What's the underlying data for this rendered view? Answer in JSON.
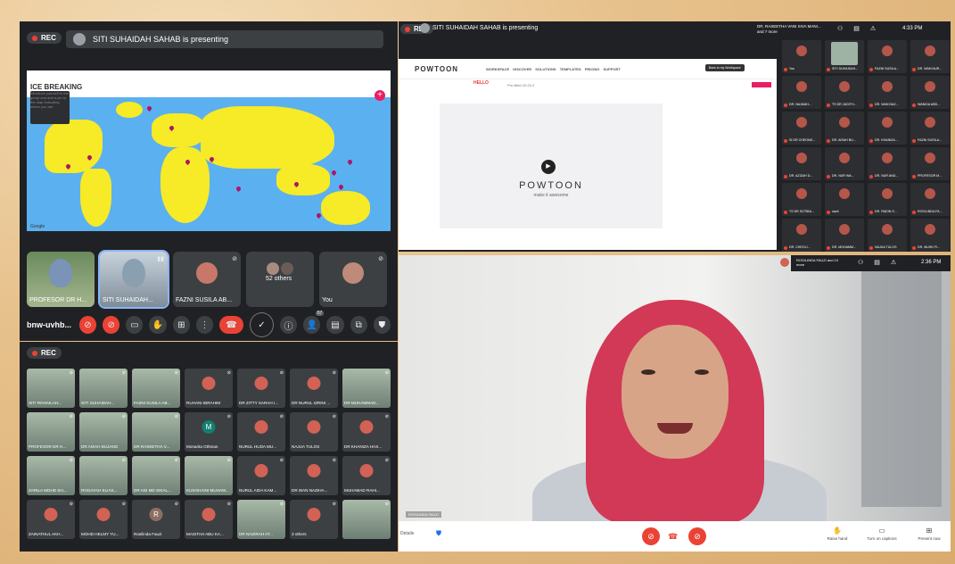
{
  "panel1": {
    "rec_label": "REC",
    "presenter_text": "SITI SUHAIDAH SAHAB is presenting",
    "map": {
      "title": "ICE BREAKING",
      "subtitle": "Introduce yourself to the group and add a pin to the map indicating where you are",
      "credit": "Google"
    },
    "tiles": [
      {
        "name": "PROFESOR DR H..."
      },
      {
        "name": "SITI SUHAIDAH..."
      },
      {
        "name": "FAZNI SUSILA AB..."
      },
      {
        "name": "52 others"
      },
      {
        "name": "You"
      }
    ],
    "meeting_code": "bnw-uvhb...",
    "people_count": "57"
  },
  "panel2": {
    "rec_label": "REC",
    "participants": [
      "SITI ROHAILAH...",
      "SITI SUHAIDAH...",
      "FAZNI SUSILA AB...",
      "RUHANI IBRAHIM",
      "DR ZITTY SARAH I...",
      "DR NURUL IZRINI ...",
      "DR MUHAMMAD...",
      "PROFESOR DR H...",
      "DR AISAH BUJANG",
      "DR RASEETHA V...",
      "Monarita Othman",
      "NURUL HUDA MU...",
      "NAJUA TULOS",
      "DR KHANIZA HAS...",
      "ZARILA MOHD SH...",
      "ROGAYAH ELIAS...",
      "DR ADI MD SIKAL...",
      "KUSOHAINI MUHAM...",
      "NURUL AIDA KAM...",
      "DR WAN NAZIHA...",
      "MUHAMAD RAHI...",
      "ZAINATHUL AKH...",
      "MOHD HELMY YU...",
      "Rosilinda Fauzi",
      "MASITAH ABU KA...",
      "DR NAZIRAH AT...",
      "3 others",
      ""
    ],
    "monarita_initial": "M",
    "rosilinda_initial": "R"
  },
  "panel3": {
    "rec_label": "REC",
    "presenter_text": "SITI SUHAIDAH SAHAB is presenting",
    "host_text": "DR. RASEETHA VANI SIVA MANI... and 7 more",
    "time": "4:33 PM",
    "site": {
      "logo": "POWTOON",
      "nav_links": "WORKSPACE DISCOVER SOLUTIONS TEMPLATES PRICING SUPPORT",
      "cta": "Back to my Workspace",
      "hello": "HELLO",
      "promo": "Pre-filled 20:23.2",
      "video_brand": "POWTOON",
      "video_tagline": "make it awesome"
    },
    "side_participants": [
      "You",
      "SITI SUHAIDAH...",
      "FAZNI SUSILA...",
      "DR. WAN NUR...",
      "DR. NAJMAH...",
      "TS DR JUDITH...",
      "DR. WAN NAZ...",
      "WANIDA ABD...",
      "SI DR CHEONG...",
      "DR. AISAH BU...",
      "DR. KHANIZA...",
      "FAZNI SUSILA...",
      "DR. AZIZAH D...",
      "DR. NUR WA...",
      "DR. NUR AND...",
      "PROFESOR M...",
      "TS DR SOTIBA...",
      "nazli",
      "DR. RADIN S...",
      "ROSILINDA FA...",
      "DR. CHEOLI...",
      "DR. MOHAMM...",
      "NAJUA TULOS",
      "DR. MUHD FI..."
    ]
  },
  "panel4": {
    "header_text": "ROSILINDA FAUZI and 10 more",
    "time": "2:36 PM",
    "speaker_caption": "ROSILINDA FAUZI",
    "left_text": "Details",
    "options": [
      "Raise hand",
      "Turn on captions",
      "Present now"
    ]
  }
}
